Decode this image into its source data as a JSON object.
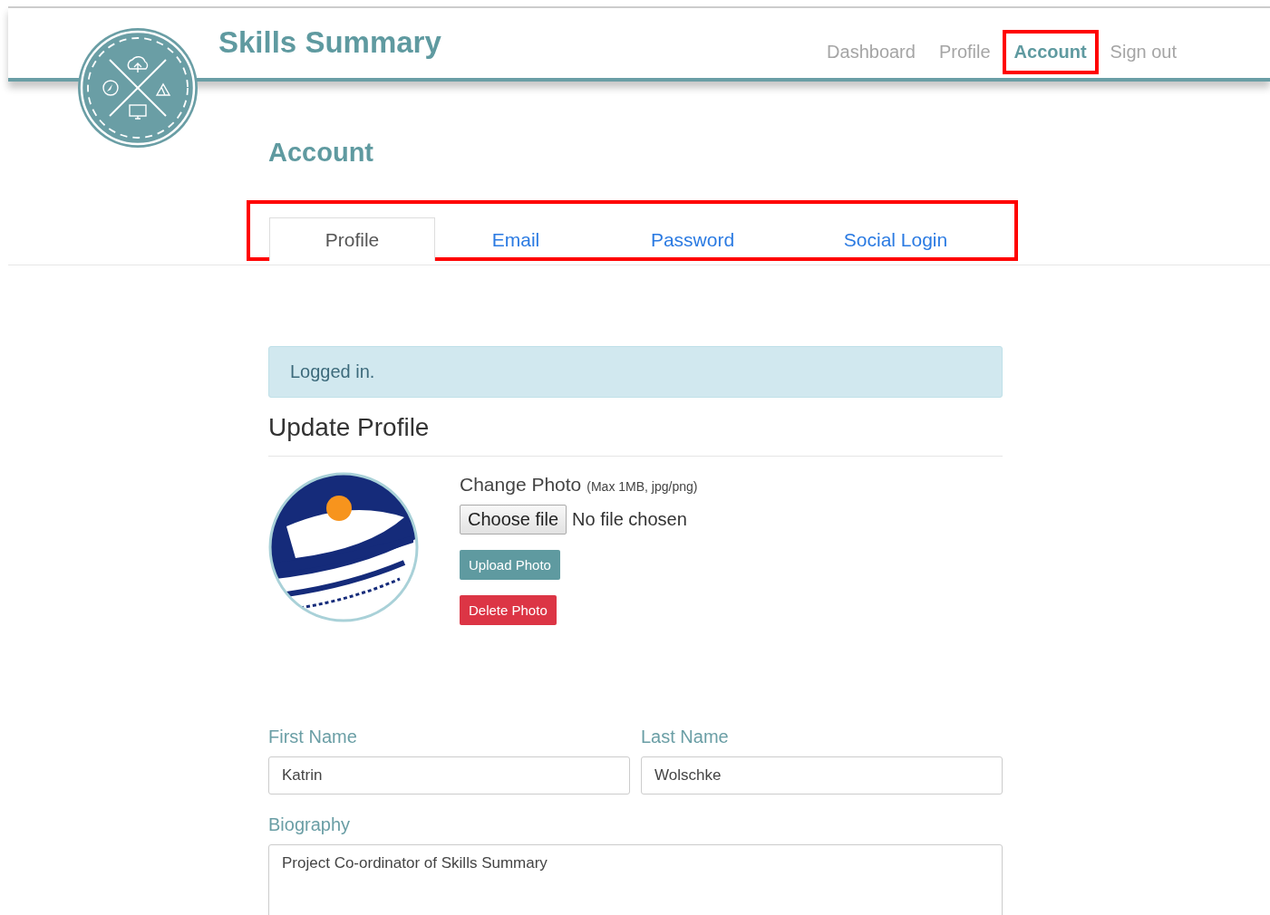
{
  "header": {
    "title": "Skills Summary",
    "nav": [
      {
        "label": "Dashboard",
        "selected": false,
        "highlighted": false
      },
      {
        "label": "Profile",
        "selected": false,
        "highlighted": false
      },
      {
        "label": "Account",
        "selected": true,
        "highlighted": true
      },
      {
        "label": "Sign out",
        "selected": false,
        "highlighted": false
      }
    ]
  },
  "page_title": "Account",
  "tabs": {
    "highlighted": true,
    "items": [
      {
        "label": "Profile",
        "selected": true
      },
      {
        "label": "Email",
        "selected": false
      },
      {
        "label": "Password",
        "selected": false
      },
      {
        "label": "Social Login",
        "selected": false
      }
    ]
  },
  "alert": "Logged in.",
  "section_title": "Update Profile",
  "photo": {
    "label": "Change Photo",
    "hint": "(Max 1MB, jpg/png)",
    "file_button": "Choose file",
    "file_status": "No file chosen",
    "upload_button": "Upload Photo",
    "delete_button": "Delete Photo"
  },
  "form": {
    "fields": [
      {
        "label": "First Name",
        "value": "Katrin"
      },
      {
        "label": "Last Name",
        "value": "Wolschke"
      }
    ],
    "biography": {
      "label": "Biography",
      "value": "Project Co-ordinator of Skills Summary"
    }
  }
}
